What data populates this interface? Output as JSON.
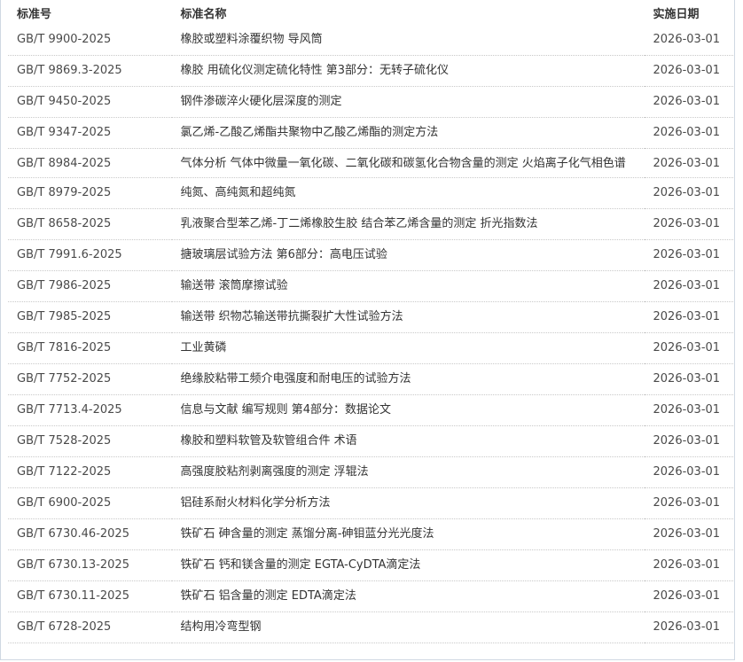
{
  "table": {
    "headers": {
      "number": "标准号",
      "name": "标准名称",
      "date": "实施日期"
    },
    "rows": [
      {
        "number": "GB/T 9900-2025",
        "name": "橡胶或塑料涂覆织物 导风筒",
        "date": "2026-03-01"
      },
      {
        "number": "GB/T 9869.3-2025",
        "name": "橡胶 用硫化仪测定硫化特性 第3部分：无转子硫化仪",
        "date": "2026-03-01"
      },
      {
        "number": "GB/T 9450-2025",
        "name": "钢件渗碳淬火硬化层深度的测定",
        "date": "2026-03-01"
      },
      {
        "number": "GB/T 9347-2025",
        "name": "氯乙烯-乙酸乙烯酯共聚物中乙酸乙烯酯的测定方法",
        "date": "2026-03-01"
      },
      {
        "number": "GB/T 8984-2025",
        "name": "气体分析 气体中微量一氧化碳、二氧化碳和碳氢化合物含量的测定 火焰离子化气相色谱",
        "date": "2026-03-01"
      },
      {
        "number": "GB/T 8979-2025",
        "name": "纯氮、高纯氮和超纯氮",
        "date": "2026-03-01"
      },
      {
        "number": "GB/T 8658-2025",
        "name": "乳液聚合型苯乙烯-丁二烯橡胶生胶 结合苯乙烯含量的测定 折光指数法",
        "date": "2026-03-01"
      },
      {
        "number": "GB/T 7991.6-2025",
        "name": "搪玻璃层试验方法 第6部分：高电压试验",
        "date": "2026-03-01"
      },
      {
        "number": "GB/T 7986-2025",
        "name": "输送带 滚筒摩擦试验",
        "date": "2026-03-01"
      },
      {
        "number": "GB/T 7985-2025",
        "name": "输送带 织物芯输送带抗撕裂扩大性试验方法",
        "date": "2026-03-01"
      },
      {
        "number": "GB/T 7816-2025",
        "name": "工业黄磷",
        "date": "2026-03-01"
      },
      {
        "number": "GB/T 7752-2025",
        "name": "绝缘胶粘带工频介电强度和耐电压的试验方法",
        "date": "2026-03-01"
      },
      {
        "number": "GB/T 7713.4-2025",
        "name": "信息与文献 编写规则 第4部分：数据论文",
        "date": "2026-03-01"
      },
      {
        "number": "GB/T 7528-2025",
        "name": "橡胶和塑料软管及软管组合件 术语",
        "date": "2026-03-01"
      },
      {
        "number": "GB/T 7122-2025",
        "name": "高强度胶粘剂剥离强度的测定 浮辊法",
        "date": "2026-03-01"
      },
      {
        "number": "GB/T 6900-2025",
        "name": "铝硅系耐火材料化学分析方法",
        "date": "2026-03-01"
      },
      {
        "number": "GB/T 6730.46-2025",
        "name": "铁矿石 砷含量的测定 蒸馏分离-砷钼蓝分光光度法",
        "date": "2026-03-01"
      },
      {
        "number": "GB/T 6730.13-2025",
        "name": "铁矿石 钙和镁含量的测定 EGTA-CyDTA滴定法",
        "date": "2026-03-01"
      },
      {
        "number": "GB/T 6730.11-2025",
        "name": "铁矿石 铝含量的测定 EDTA滴定法",
        "date": "2026-03-01"
      },
      {
        "number": "GB/T 6728-2025",
        "name": "结构用冷弯型钢",
        "date": "2026-03-01"
      }
    ]
  }
}
